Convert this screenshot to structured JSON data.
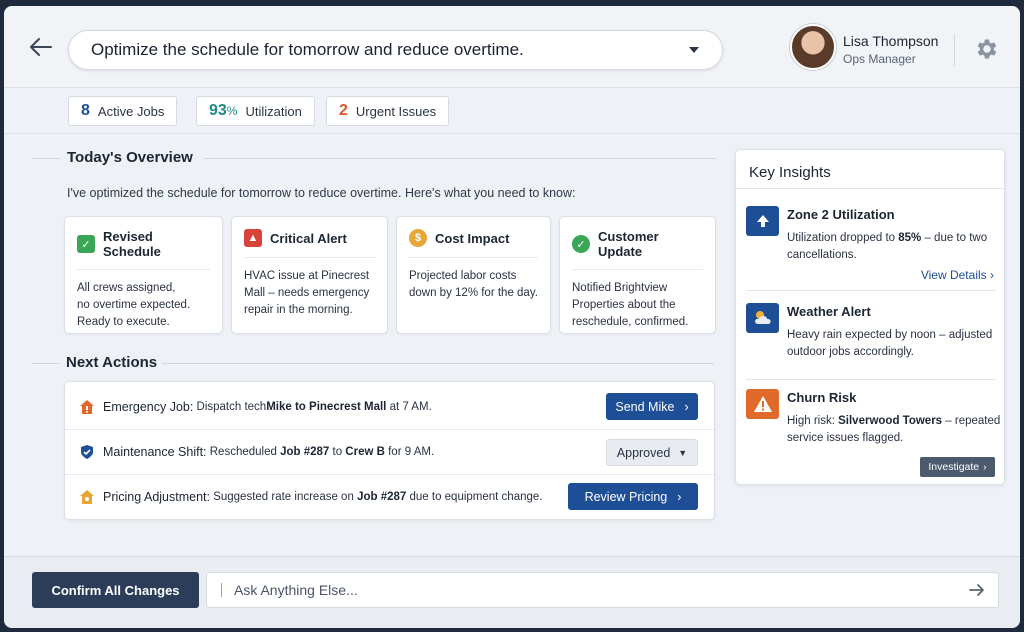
{
  "header": {
    "prompt": "Optimize the schedule for tomorrow and reduce overtime.",
    "user": {
      "name": "Lisa Thompson",
      "role": "Ops Manager"
    }
  },
  "stats": [
    {
      "value": "8",
      "label": "Active Jobs",
      "color": "#1d4e96"
    },
    {
      "value": "93",
      "suffix": "%",
      "label": "Utilization",
      "color": "#1f8a86"
    },
    {
      "value": "2",
      "label": "Urgent Issues",
      "color": "#d4572a"
    }
  ],
  "overview": {
    "title": "Today's Overview",
    "intro": "I've optimized the schedule for tomorrow to reduce overtime. Here's what you need to know:",
    "cards": [
      {
        "title": "Revised Schedule",
        "icon": "check-icon",
        "color": "#3aa657",
        "lines": [
          "All crews assigned,",
          "no overtime expected.",
          "Ready to execute."
        ]
      },
      {
        "title": "Critical Alert",
        "icon": "alert-icon",
        "color": "#d9443a",
        "lines": [
          "HVAC issue at Pinecrest",
          "Mall – needs emergency",
          "repair in the morning."
        ]
      },
      {
        "title": "Cost Impact",
        "icon": "dollar-icon",
        "color": "#e8a634",
        "lines": [
          "Projected labor costs",
          "down by 12% for the day."
        ]
      },
      {
        "title": "Customer Update",
        "icon": "check-circle-icon",
        "color": "#3aa657",
        "lines": [
          "Notified Brightview",
          "Properties about the",
          "reschedule, confirmed."
        ]
      }
    ]
  },
  "next_actions": {
    "title": "Next Actions",
    "items": [
      {
        "lead": "Emergency Job:",
        "text_1": "Dispatch tech ",
        "bold_1": "Mike to Pinecrest Mall",
        "text_2": " at 7 AM.",
        "button": "Send Mike",
        "icon": "home-alert-icon"
      },
      {
        "lead": "Maintenance Shift:",
        "text_1": "Rescheduled ",
        "bold_1": "Job #287",
        "text_2": " to ",
        "bold_2": "Crew B",
        "text_3": " for 9 AM.",
        "button": "Approved",
        "icon": "shield-icon"
      },
      {
        "lead": "Pricing Adjustment:",
        "text_1": "Suggested rate increase on ",
        "bold_1": "Job #287",
        "text_2": " due to equipment change.",
        "button": "Review Pricing",
        "icon": "tag-icon"
      }
    ]
  },
  "insights": {
    "title": "Key Insights",
    "items": [
      {
        "title": "Zone 2 Utilization",
        "text_1": "Utilization dropped to ",
        "bold": "85%",
        "text_2": " – due to two cancellations.",
        "link": "View Details",
        "icon": "arrow-up-icon",
        "color": "#1d4e96"
      },
      {
        "title": "Weather Alert",
        "text_1": "Heavy rain expected by noon – adjusted outdoor jobs accordingly.",
        "icon": "weather-icon",
        "color": "#1d4e96"
      },
      {
        "title": "Churn Risk",
        "text_1": "High risk: ",
        "bold": "Silverwood Towers",
        "text_2": " – repeated service issues flagged.",
        "button": "Investigate",
        "icon": "warning-icon",
        "color": "#e06a2a"
      }
    ]
  },
  "footer": {
    "confirm": "Confirm All Changes",
    "ask_placeholder": "Ask Anything Else..."
  }
}
